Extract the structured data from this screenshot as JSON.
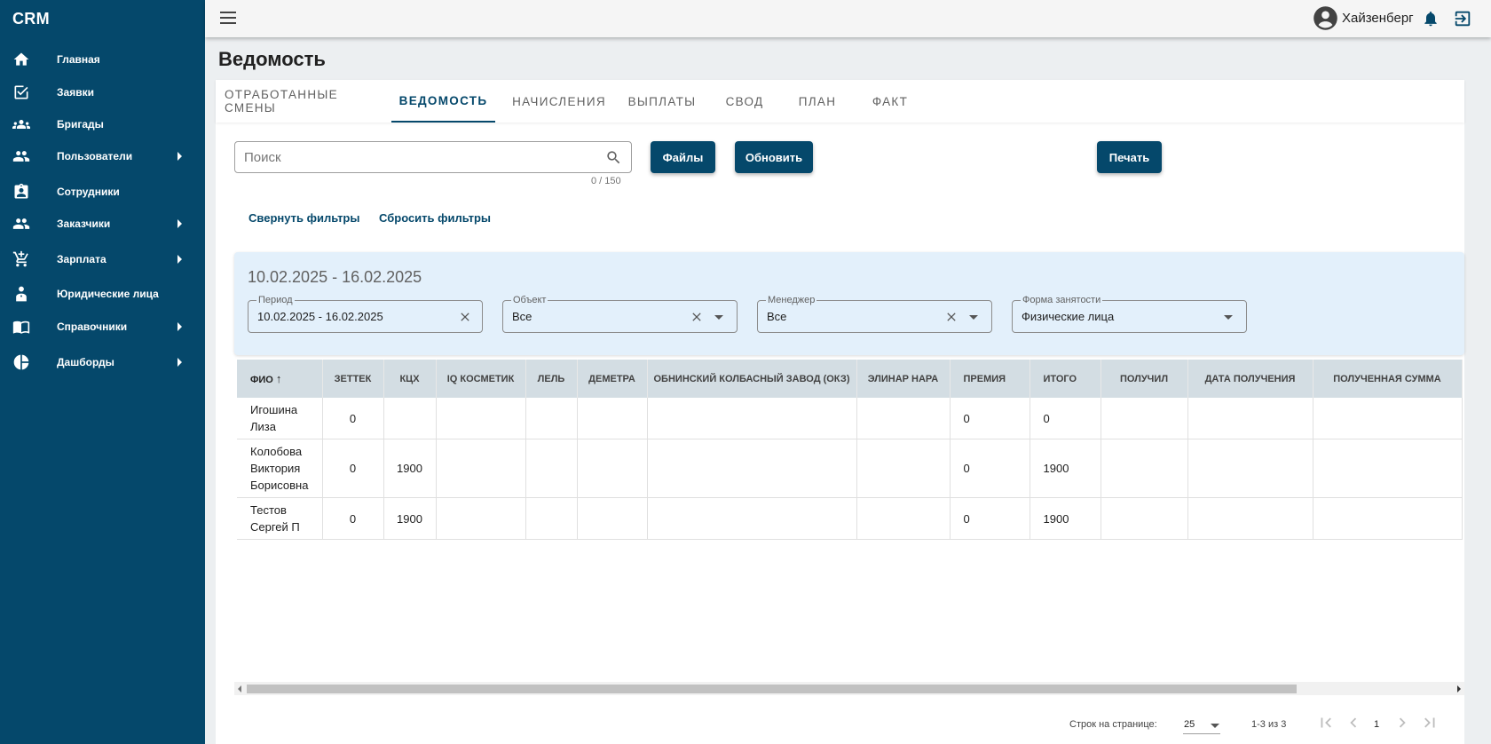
{
  "app": {
    "brand": "CRM"
  },
  "sidebar": {
    "items": [
      {
        "label": "Главная",
        "icon": "home-icon",
        "arrow": false
      },
      {
        "label": "Заявки",
        "icon": "checkbox-icon",
        "arrow": false
      },
      {
        "label": "Бригады",
        "icon": "group-icon",
        "arrow": false
      },
      {
        "label": "Пользователи",
        "icon": "users-icon",
        "arrow": true
      },
      {
        "label": "Сотрудники",
        "icon": "clipboard-person-icon",
        "arrow": false
      },
      {
        "label": "Заказчики",
        "icon": "customers-icon",
        "arrow": true
      },
      {
        "label": "Зарплата",
        "icon": "cart-plus-icon",
        "arrow": true
      },
      {
        "label": "Юридические лица",
        "icon": "legal-person-icon",
        "arrow": false
      },
      {
        "label": "Справочники",
        "icon": "book-icon",
        "arrow": true
      },
      {
        "label": "Дашборды",
        "icon": "pie-chart-icon",
        "arrow": true
      }
    ]
  },
  "topbar": {
    "username": "Хайзенберг"
  },
  "page": {
    "title": "Ведомость"
  },
  "tabs": [
    {
      "label": "ОТРАБОТАННЫЕ СМЕНЫ"
    },
    {
      "label": "ВЕДОМОСТЬ",
      "active": true
    },
    {
      "label": "НАЧИСЛЕНИЯ"
    },
    {
      "label": "ВЫПЛАТЫ"
    },
    {
      "label": "СВОД"
    },
    {
      "label": "ПЛАН"
    },
    {
      "label": "ФАКТ"
    }
  ],
  "search": {
    "placeholder": "Поиск",
    "value": "",
    "counter": "0 / 150"
  },
  "buttons": {
    "files": "Файлы",
    "refresh": "Обновить",
    "print": "Печать"
  },
  "filter_actions": {
    "collapse": "Свернуть фильтры",
    "reset": "Сбросить фильтры"
  },
  "filters": {
    "period_title": "10.02.2025 - 16.02.2025",
    "period": {
      "label": "Период",
      "value": "10.02.2025 - 16.02.2025"
    },
    "object": {
      "label": "Объект",
      "value": "Все"
    },
    "manager": {
      "label": "Менеджер",
      "value": "Все"
    },
    "employment": {
      "label": "Форма занятости",
      "value": "Физические лица"
    }
  },
  "table": {
    "columns": [
      "ФИО",
      "ЗЕТТЕК",
      "КЦХ",
      "IQ КОСМЕТИК",
      "ЛЕЛЬ",
      "ДЕМЕТРА",
      "ОБНИНСКИЙ КОЛБАСНЫЙ ЗАВОД (ОКЗ)",
      "ЭЛИНАР НАРА",
      "ПРЕМИЯ",
      "ИТОГО",
      "ПОЛУЧИЛ",
      "ДАТА ПОЛУЧЕНИЯ",
      "ПОЛУЧЕННАЯ СУММА"
    ],
    "sort_column": "ФИО",
    "rows": [
      {
        "fio": [
          "Игошина",
          "Лиза"
        ],
        "cells": [
          "0",
          "",
          "",
          "",
          "",
          "",
          "",
          "0",
          "0",
          "",
          "",
          ""
        ]
      },
      {
        "fio": [
          "Колобова",
          "Виктория",
          "Борисовна"
        ],
        "cells": [
          "0",
          "1900",
          "",
          "",
          "",
          "",
          "",
          "0",
          "1900",
          "",
          "",
          ""
        ]
      },
      {
        "fio": [
          "Тестов",
          "Сергей П"
        ],
        "cells": [
          "0",
          "1900",
          "",
          "",
          "",
          "",
          "",
          "0",
          "1900",
          "",
          "",
          ""
        ]
      }
    ]
  },
  "pagination": {
    "rows_per_page_label": "Строк на странице:",
    "rows_per_page": "25",
    "range": "1-3 из 3",
    "page": "1"
  }
}
